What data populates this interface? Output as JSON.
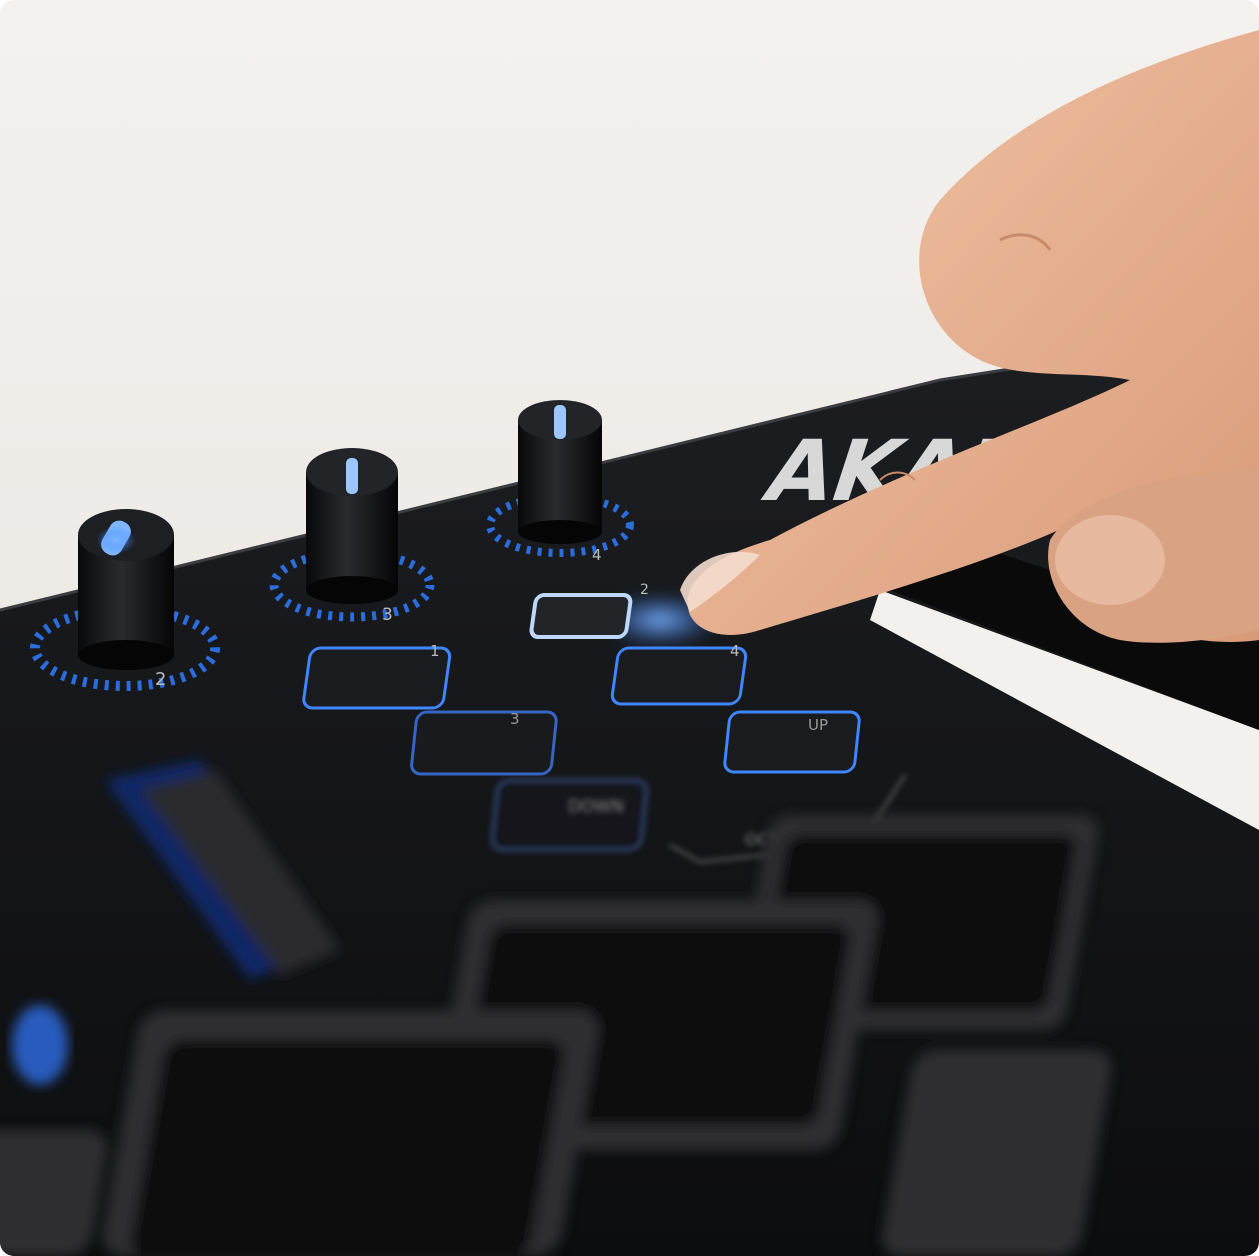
{
  "photo": {
    "brand_logo": "AKAI",
    "knob_labels": [
      "2",
      "3",
      "4"
    ],
    "pad_button_labels": [
      "1",
      "2",
      "3",
      "4"
    ],
    "octave_labels": {
      "down": "DOWN",
      "up": "UP",
      "group": "OCTAVE"
    }
  },
  "colors": {
    "led_blue": "#2f7dff",
    "led_glow": "#7fb6ff",
    "device_body": "#131416",
    "background": "#efece8",
    "skin": "#e7b08f"
  }
}
